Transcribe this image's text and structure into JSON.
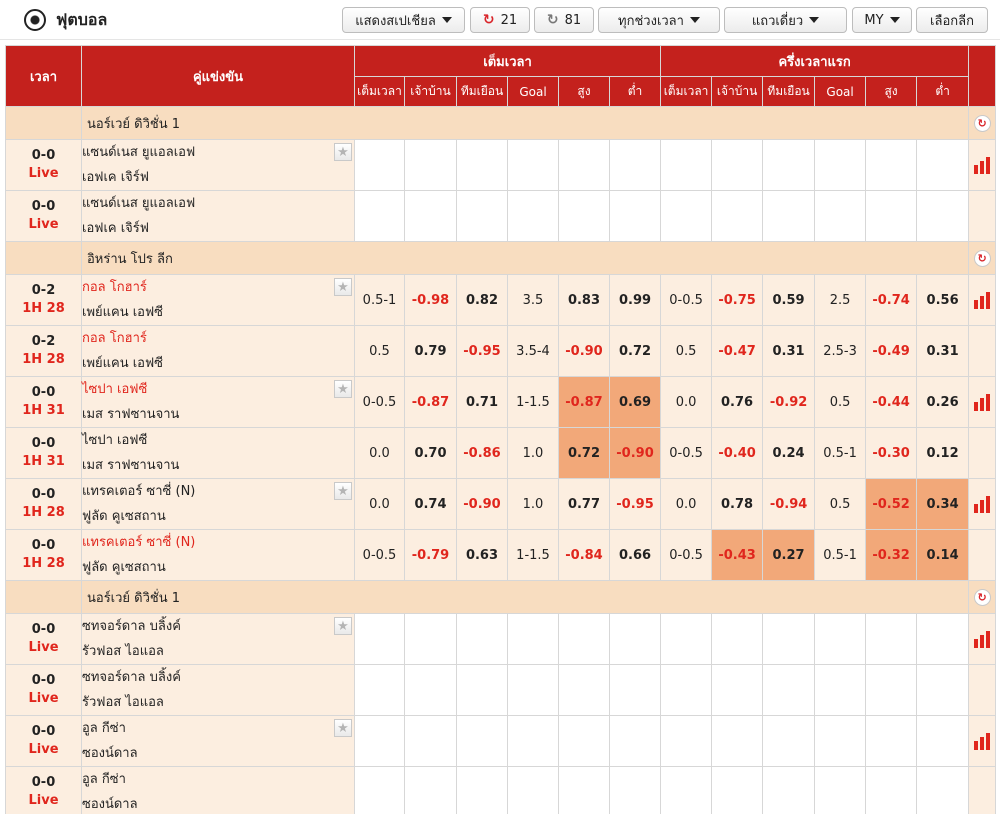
{
  "header": {
    "title": "ฟุตบอล",
    "ball_icon": "soccer-ball-icon",
    "special_dropdown": "แสดงสเปเชียล",
    "live_count": "21",
    "refresh_count": "81",
    "time_dropdown": "ทุกช่วงเวลา",
    "layout_dropdown": "แถวเดี่ยว",
    "odds_format": "MY",
    "league_select": "เลือกลีก"
  },
  "columns": {
    "time": "เวลา",
    "match": "คู่แข่งขัน",
    "full_time": "เต็มเวลา",
    "first_half": "ครึ่งเวลาแรก",
    "sub": [
      "เต็มเวลา",
      "เจ้าบ้าน",
      "ทีมเยือน",
      "Goal",
      "สูง",
      "ต่ำ"
    ]
  },
  "colors": {
    "header_red": "#c4211d",
    "negative_red": "#e0261d",
    "highlight_orange": "#f2a879"
  },
  "leagues": [
    {
      "name": "นอร์เวย์ ดิวิชั่น 1",
      "matches": [
        {
          "score": "0-0",
          "status": "Live",
          "home": "แซนด์เนส ยูแอลเอฟ",
          "away": "เอฟเค เจิร์ฟ",
          "home_red": false,
          "fav": true,
          "stats": true,
          "ft": [
            "",
            "",
            "",
            "",
            "",
            ""
          ],
          "fh": [
            "",
            "",
            "",
            "",
            "",
            ""
          ]
        },
        {
          "score": "0-0",
          "status": "Live",
          "home": "แซนด์เนส ยูแอลเอฟ",
          "away": "เอฟเค เจิร์ฟ",
          "home_red": false,
          "fav": false,
          "stats": false,
          "ft": [
            "",
            "",
            "",
            "",
            "",
            ""
          ],
          "fh": [
            "",
            "",
            "",
            "",
            "",
            ""
          ]
        }
      ]
    },
    {
      "name": "อิหร่าน โปร ลีก",
      "matches": [
        {
          "score": "0-2",
          "status": "1H 28",
          "home": "กอล โกฮาร์",
          "away": "เพย์แคน เอฟซี",
          "home_red": true,
          "fav": true,
          "stats": true,
          "ft": [
            "0.5-1",
            "-0.98",
            "0.82",
            "3.5",
            "0.83",
            "0.99"
          ],
          "fh": [
            "0-0.5",
            "-0.75",
            "0.59",
            "2.5",
            "-0.74",
            "0.56"
          ],
          "hl_ft": [],
          "hl_fh": []
        },
        {
          "score": "0-2",
          "status": "1H 28",
          "home": "กอล โกฮาร์",
          "away": "เพย์แคน เอฟซี",
          "home_red": true,
          "fav": false,
          "stats": false,
          "ft": [
            "0.5",
            "0.79",
            "-0.95",
            "3.5-4",
            "-0.90",
            "0.72"
          ],
          "fh": [
            "0.5",
            "-0.47",
            "0.31",
            "2.5-3",
            "-0.49",
            "0.31"
          ],
          "hl_ft": [],
          "hl_fh": []
        },
        {
          "score": "0-0",
          "status": "1H 31",
          "home": "ไซปา เอฟซี",
          "away": "เมส ราฟซานจาน",
          "home_red": true,
          "fav": true,
          "stats": true,
          "ft": [
            "0-0.5",
            "-0.87",
            "0.71",
            "1-1.5",
            "-0.87",
            "0.69"
          ],
          "fh": [
            "0.0",
            "0.76",
            "-0.92",
            "0.5",
            "-0.44",
            "0.26"
          ],
          "hl_ft": [
            4,
            5
          ],
          "hl_fh": []
        },
        {
          "score": "0-0",
          "status": "1H 31",
          "home": "ไซปา เอฟซี",
          "away": "เมส ราฟซานจาน",
          "home_red": false,
          "fav": false,
          "stats": false,
          "ft": [
            "0.0",
            "0.70",
            "-0.86",
            "1.0",
            "0.72",
            "-0.90"
          ],
          "fh": [
            "0-0.5",
            "-0.40",
            "0.24",
            "0.5-1",
            "-0.30",
            "0.12"
          ],
          "hl_ft": [
            4,
            5
          ],
          "hl_fh": []
        },
        {
          "score": "0-0",
          "status": "1H 28",
          "home": "แทรคเตอร์ ซาซี่ (N)",
          "away": "ฟูลัด คูเซสถาน",
          "home_red": false,
          "fav": true,
          "stats": true,
          "ft": [
            "0.0",
            "0.74",
            "-0.90",
            "1.0",
            "0.77",
            "-0.95"
          ],
          "fh": [
            "0.0",
            "0.78",
            "-0.94",
            "0.5",
            "-0.52",
            "0.34"
          ],
          "hl_ft": [],
          "hl_fh": [
            4,
            5
          ]
        },
        {
          "score": "0-0",
          "status": "1H 28",
          "home": "แทรคเตอร์ ซาซี่ (N)",
          "away": "ฟูลัด คูเซสถาน",
          "home_red": true,
          "fav": false,
          "stats": false,
          "ft": [
            "0-0.5",
            "-0.79",
            "0.63",
            "1-1.5",
            "-0.84",
            "0.66"
          ],
          "fh": [
            "0-0.5",
            "-0.43",
            "0.27",
            "0.5-1",
            "-0.32",
            "0.14"
          ],
          "hl_ft": [],
          "hl_fh": [
            1,
            2,
            4,
            5
          ]
        }
      ]
    },
    {
      "name": "นอร์เวย์ ดิวิชั่น 1",
      "matches": [
        {
          "score": "0-0",
          "status": "Live",
          "home": "ซทจอร์ดาล บลิ้งค์",
          "away": "รัวฟอส ไอแอล",
          "home_red": false,
          "fav": true,
          "stats": true,
          "ft": [
            "",
            "",
            "",
            "",
            "",
            ""
          ],
          "fh": [
            "",
            "",
            "",
            "",
            "",
            ""
          ]
        },
        {
          "score": "0-0",
          "status": "Live",
          "home": "ซทจอร์ดาล บลิ้งค์",
          "away": "รัวฟอส ไอแอล",
          "home_red": false,
          "fav": false,
          "stats": false,
          "ft": [
            "",
            "",
            "",
            "",
            "",
            ""
          ],
          "fh": [
            "",
            "",
            "",
            "",
            "",
            ""
          ]
        },
        {
          "score": "0-0",
          "status": "Live",
          "home": "อูล กีซ่า",
          "away": "ซองน์ดาล",
          "home_red": false,
          "fav": true,
          "stats": true,
          "ft": [
            "",
            "",
            "",
            "",
            "",
            ""
          ],
          "fh": [
            "",
            "",
            "",
            "",
            "",
            ""
          ]
        },
        {
          "score": "0-0",
          "status": "Live",
          "home": "อูล กีซ่า",
          "away": "ซองน์ดาล",
          "home_red": false,
          "fav": false,
          "stats": false,
          "ft": [
            "",
            "",
            "",
            "",
            "",
            ""
          ],
          "fh": [
            "",
            "",
            "",
            "",
            "",
            ""
          ]
        }
      ]
    }
  ]
}
